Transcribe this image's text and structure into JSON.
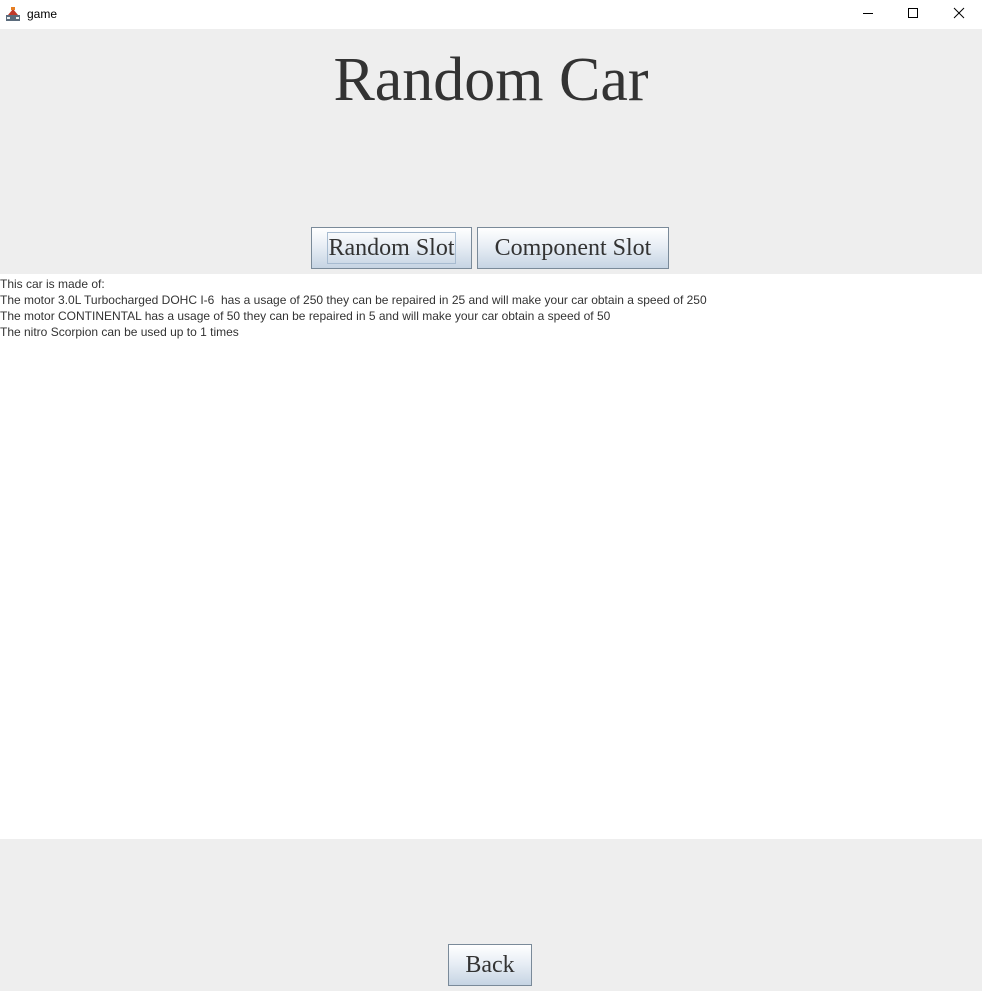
{
  "window": {
    "title": "game"
  },
  "heading": "Random Car",
  "buttons": {
    "random_slot": "Random Slot",
    "component_slot": "Component Slot",
    "back": "Back"
  },
  "output": {
    "lines": [
      "This car is made of:",
      "The motor 3.0L Turbocharged DOHC I-6  has a usage of 250 they can be repaired in 25 and will make your car obtain a speed of 250",
      "The motor CONTINENTAL has a usage of 50 they can be repaired in 5 and will make your car obtain a speed of 50",
      "The nitro Scorpion can be used up to 1 times"
    ]
  },
  "icons": {
    "app": "java-app-icon",
    "minimize": "minimize-icon",
    "maximize": "maximize-icon",
    "close": "close-icon"
  }
}
